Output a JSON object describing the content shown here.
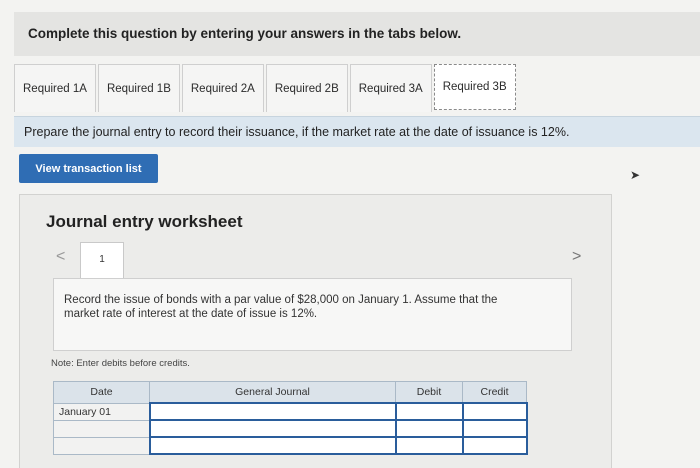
{
  "header": {
    "text": "Complete this question by entering your answers in the tabs below."
  },
  "tabs": [
    {
      "label": "Required 1A",
      "active": false
    },
    {
      "label": "Required 1B",
      "active": false
    },
    {
      "label": "Required 2A",
      "active": false
    },
    {
      "label": "Required 2B",
      "active": false
    },
    {
      "label": "Required 3A",
      "active": false
    },
    {
      "label": "Required 3B",
      "active": true
    }
  ],
  "instruction": "Prepare the journal entry to record their issuance, if the market rate at the date of issuance is 12%.",
  "view_button": "View transaction list",
  "worksheet": {
    "title": "Journal entry worksheet",
    "nav_prev": "<",
    "nav_next": ">",
    "page": "1",
    "record_text": "Record the issue of bonds with a par value of $28,000 on January 1. Assume that the market rate of interest at the date of issue is 12%.",
    "note": "Note: Enter debits before credits.",
    "table": {
      "headers": {
        "date": "Date",
        "journal": "General Journal",
        "debit": "Debit",
        "credit": "Credit"
      },
      "rows": [
        {
          "date": "January 01",
          "journal": "",
          "debit": "",
          "credit": ""
        },
        {
          "date": "",
          "journal": "",
          "debit": "",
          "credit": ""
        },
        {
          "date": "",
          "journal": "",
          "debit": "",
          "credit": ""
        }
      ]
    }
  }
}
